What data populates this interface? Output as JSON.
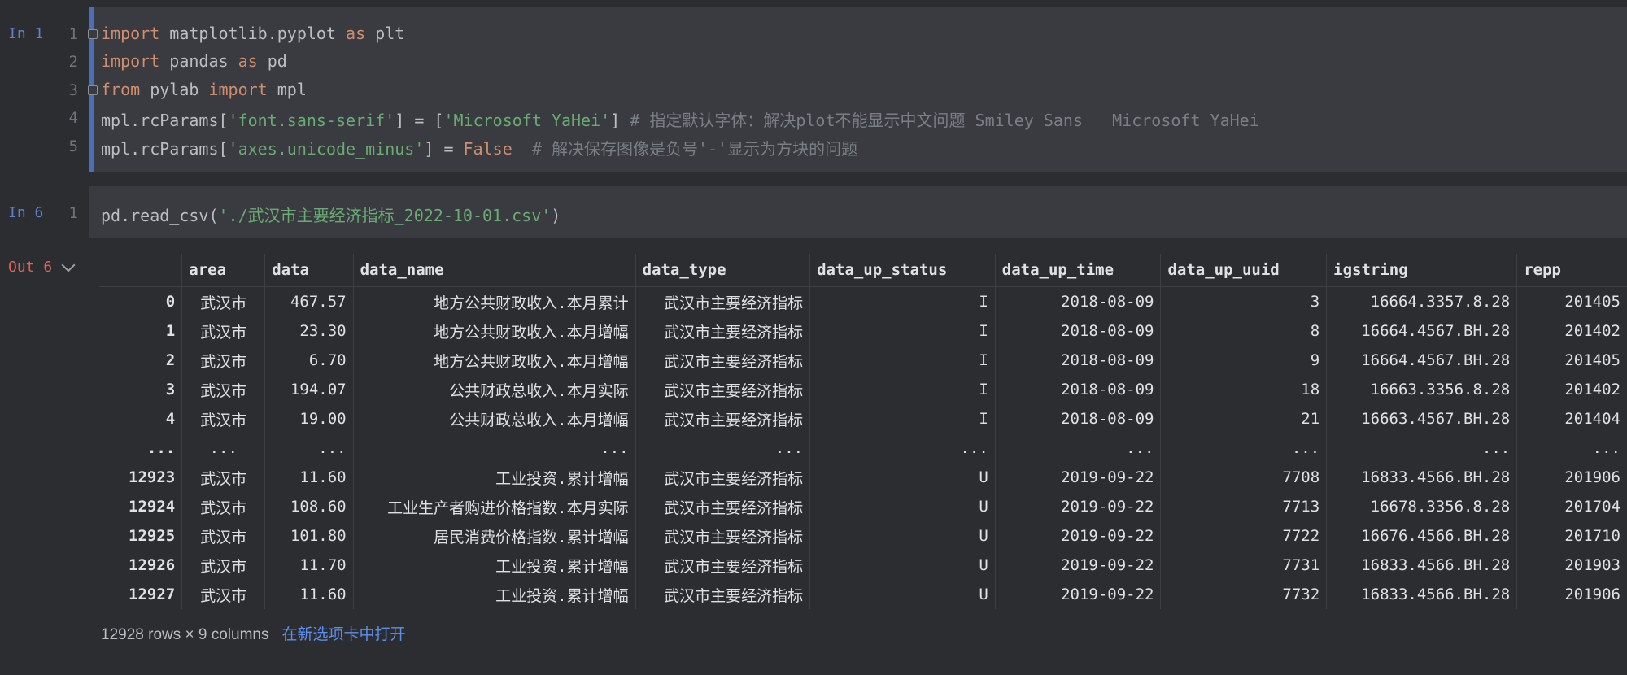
{
  "cell1": {
    "prompt": "In 1",
    "line_numbers": [
      "1",
      "2",
      "3",
      "4",
      "5"
    ]
  },
  "cell2": {
    "prompt": "In 6",
    "line_numbers": [
      "1"
    ],
    "code": [
      "pd.read_csv(",
      "'./武汉市主要经济指标_2022-10-01.csv'",
      ")"
    ]
  },
  "output": {
    "prompt": "Out 6",
    "columns": [
      "",
      "area",
      "data",
      "data_name",
      "data_type",
      "data_up_status",
      "data_up_time",
      "data_up_uuid",
      "igstring",
      "repp"
    ],
    "rows": [
      [
        "0",
        "武汉市",
        "467.57",
        "地方公共财政收入.本月累计",
        "武汉市主要经济指标",
        "I",
        "2018-08-09",
        "3",
        "16664.3357.8.28",
        "201405"
      ],
      [
        "1",
        "武汉市",
        "23.30",
        "地方公共财政收入.本月增幅",
        "武汉市主要经济指标",
        "I",
        "2018-08-09",
        "8",
        "16664.4567.BH.28",
        "201402"
      ],
      [
        "2",
        "武汉市",
        "6.70",
        "地方公共财政收入.本月增幅",
        "武汉市主要经济指标",
        "I",
        "2018-08-09",
        "9",
        "16664.4567.BH.28",
        "201405"
      ],
      [
        "3",
        "武汉市",
        "194.07",
        "公共财政总收入.本月实际",
        "武汉市主要经济指标",
        "I",
        "2018-08-09",
        "18",
        "16663.3356.8.28",
        "201402"
      ],
      [
        "4",
        "武汉市",
        "19.00",
        "公共财政总收入.本月增幅",
        "武汉市主要经济指标",
        "I",
        "2018-08-09",
        "21",
        "16663.4567.BH.28",
        "201404"
      ],
      [
        "...",
        "...",
        "...",
        "...",
        "...",
        "...",
        "...",
        "...",
        "...",
        "..."
      ],
      [
        "12923",
        "武汉市",
        "11.60",
        "工业投资.累计增幅",
        "武汉市主要经济指标",
        "U",
        "2019-09-22",
        "7708",
        "16833.4566.BH.28",
        "201906"
      ],
      [
        "12924",
        "武汉市",
        "108.60",
        "工业生产者购进价格指数.本月实际",
        "武汉市主要经济指标",
        "U",
        "2019-09-22",
        "7713",
        "16678.3356.8.28",
        "201704"
      ],
      [
        "12925",
        "武汉市",
        "101.80",
        "居民消费价格指数.累计增幅",
        "武汉市主要经济指标",
        "U",
        "2019-09-22",
        "7722",
        "16676.4566.BH.28",
        "201710"
      ],
      [
        "12926",
        "武汉市",
        "11.70",
        "工业投资.累计增幅",
        "武汉市主要经济指标",
        "U",
        "2019-09-22",
        "7731",
        "16833.4566.BH.28",
        "201903"
      ],
      [
        "12927",
        "武汉市",
        "11.60",
        "工业投资.累计增幅",
        "武汉市主要经济指标",
        "U",
        "2019-09-22",
        "7732",
        "16833.4566.BH.28",
        "201906"
      ]
    ],
    "summary": "12928 rows × 9 columns",
    "open_tab_link": "在新选项卡中打开"
  },
  "colors": {
    "keyword": "#cf8e6d",
    "string": "#6aab73",
    "comment": "#7a7e85",
    "link": "#5d8ff0"
  }
}
